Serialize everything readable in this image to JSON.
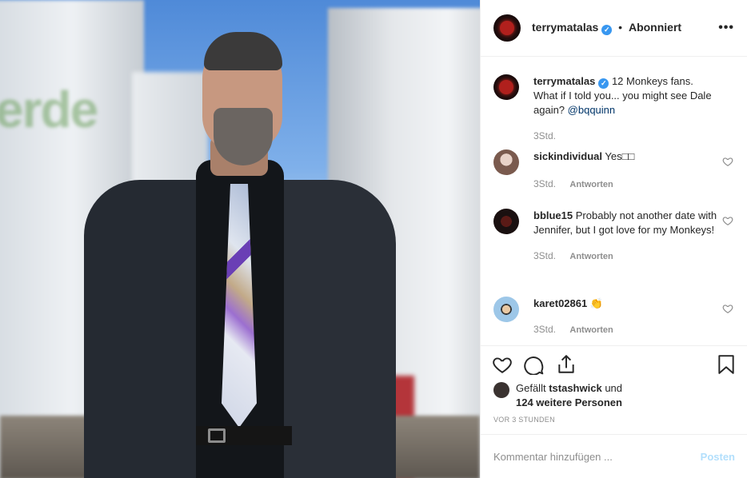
{
  "header": {
    "username": "terrymatalas",
    "separator": "•",
    "follow_status": "Abonniert",
    "more_label": "•••"
  },
  "caption": {
    "username": "terrymatalas",
    "text": "12 Monkeys fans. What if I told you... you might see Dale again?",
    "mention": "@bqquinn",
    "time": "3Std."
  },
  "comments": [
    {
      "username": "sickindividual",
      "text": "Yes□□",
      "time": "3Std.",
      "reply": "Antworten"
    },
    {
      "username": "bblue15",
      "text": "Probably not another date with Jennifer, but I got love for my Monkeys!",
      "time": "3Std.",
      "reply": "Antworten"
    },
    {
      "username": "karet02861",
      "text": "👏",
      "time": "3Std.",
      "reply": "Antworten"
    }
  ],
  "actions": {
    "like_icon": "heart-icon",
    "comment_icon": "comment-icon",
    "share_icon": "share-icon",
    "bookmark_icon": "bookmark-icon"
  },
  "likes": {
    "prefix": "Gefällt",
    "user": "tstashwick",
    "conj": "und",
    "others": "124 weitere Personen"
  },
  "time_ago": "VOR 3 STUNDEN",
  "add_comment": {
    "placeholder": "Kommentar hinzufügen ...",
    "post_label": "Posten"
  },
  "colors": {
    "verified": "#3897f0",
    "post_disabled": "#b2dffc",
    "muted": "#8e8e8e"
  }
}
